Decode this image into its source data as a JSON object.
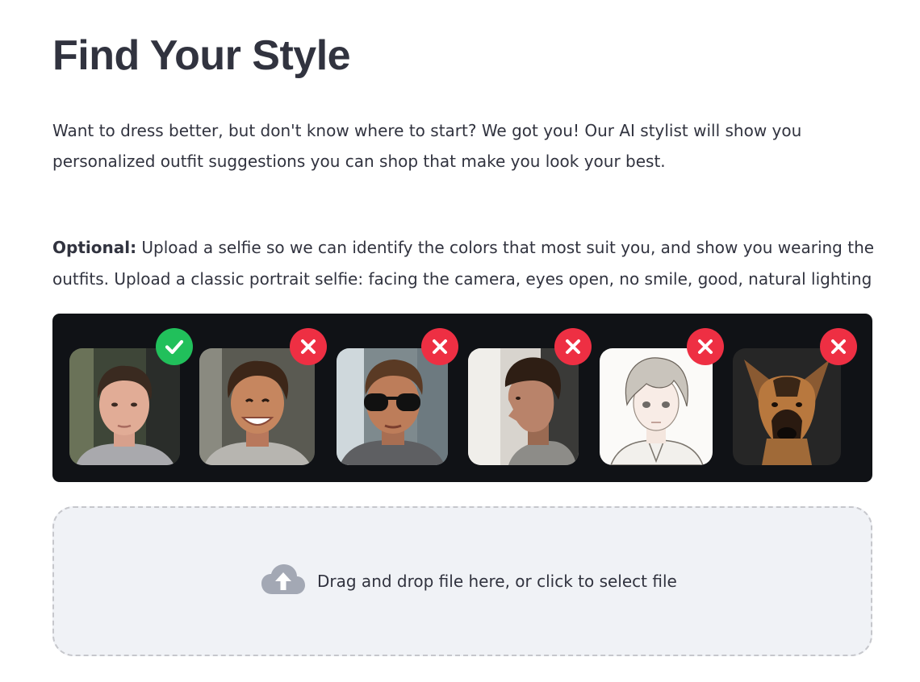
{
  "page": {
    "title": "Find Your Style",
    "intro": "Want to dress better, but don't know where to start? We got you! Our AI stylist will show you personalized outfit suggestions you can shop that make you look your best.",
    "optional_label": "Optional:",
    "optional_text": " Upload a selfie so we can identify the colors that most suit you, and show you wearing the outfits. Upload a classic portrait selfie: facing the camera, eyes open, no smile, good, natural lighting"
  },
  "examples": [
    {
      "kind": "good-selfie",
      "status": "accepted"
    },
    {
      "kind": "smiling-selfie",
      "status": "rejected"
    },
    {
      "kind": "sunglasses-selfie",
      "status": "rejected"
    },
    {
      "kind": "profile-selfie",
      "status": "rejected"
    },
    {
      "kind": "drawing-portrait",
      "status": "rejected"
    },
    {
      "kind": "dog-photo",
      "status": "rejected"
    }
  ],
  "upload": {
    "icon": "cloud-upload-icon",
    "text": "Drag and drop file here, or click to select file"
  },
  "colors": {
    "accepted": "#21c05b",
    "rejected": "#ee2f43",
    "strip_background": "#101216",
    "dropzone_background": "#f0f2f6",
    "text": "#31333f"
  }
}
